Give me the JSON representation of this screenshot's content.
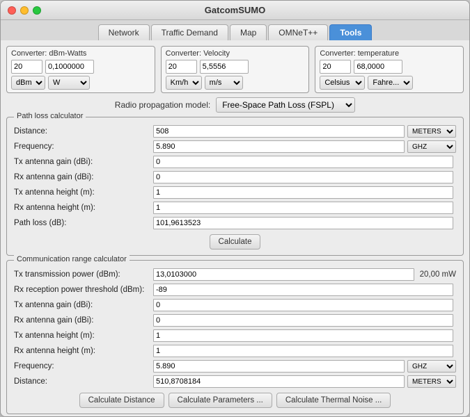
{
  "window": {
    "title": "GatcomSUMO"
  },
  "tabs": [
    {
      "id": "network",
      "label": "Network",
      "active": false
    },
    {
      "id": "traffic-demand",
      "label": "Traffic Demand",
      "active": false
    },
    {
      "id": "map",
      "label": "Map",
      "active": false
    },
    {
      "id": "omnet",
      "label": "OMNeT++",
      "active": false
    },
    {
      "id": "tools",
      "label": "Tools",
      "active": true
    }
  ],
  "converters": {
    "dbm_watts": {
      "title": "Converter: dBm-Watts",
      "value1": "20",
      "value2": "0,1000000",
      "unit1": "dBm",
      "unit2": "W"
    },
    "velocity": {
      "title": "Converter: Velocity",
      "value1": "20",
      "value2": "5,5556",
      "unit1": "Km/h",
      "unit2": "m/s"
    },
    "temperature": {
      "title": "Converter: temperature",
      "value1": "20",
      "value2": "68,0000",
      "unit1": "Celsius",
      "unit2": "Fahre..."
    }
  },
  "radio_propagation": {
    "label": "Radio propagation model:",
    "selected": "Free-Space Path Loss (FSPL)"
  },
  "path_loss": {
    "section_title": "Path loss calculator",
    "fields": [
      {
        "label": "Distance:",
        "value": "508"
      },
      {
        "label": "Frequency:",
        "value": "5.890"
      },
      {
        "label": "Tx antenna gain (dBi):",
        "value": "0"
      },
      {
        "label": "Rx antenna gain (dBi):",
        "value": "0"
      },
      {
        "label": "Tx antenna height (m):",
        "value": "1"
      },
      {
        "label": "Rx antenna height (m):",
        "value": "1"
      },
      {
        "label": "Path loss (dB):",
        "value": "101,9613523"
      }
    ],
    "units": {
      "distance": "METERS",
      "frequency": "GHZ"
    },
    "calculate_btn": "Calculate"
  },
  "comm_range": {
    "section_title": "Communication range calculator",
    "fields": [
      {
        "label": "Tx transmission power (dBm):",
        "value": "13,0103000",
        "extra": "20,00 mW"
      },
      {
        "label": "Rx reception power threshold (dBm):",
        "value": "-89",
        "extra": ""
      },
      {
        "label": "Tx antenna gain (dBi):",
        "value": "0",
        "extra": ""
      },
      {
        "label": "Rx antenna gain (dBi):",
        "value": "0",
        "extra": ""
      },
      {
        "label": "Tx antenna height (m):",
        "value": "1",
        "extra": ""
      },
      {
        "label": "Rx antenna height (m):",
        "value": "1",
        "extra": ""
      },
      {
        "label": "Frequency:",
        "value": "5.890",
        "extra": ""
      },
      {
        "label": "Distance:",
        "value": "510,8708184",
        "extra": ""
      }
    ],
    "units": {
      "frequency": "GHZ",
      "distance": "METERS"
    },
    "buttons": {
      "calc_distance": "Calculate Distance",
      "calc_params": "Calculate Parameters ...",
      "calc_thermal": "Calculate Thermal Noise ..."
    }
  }
}
